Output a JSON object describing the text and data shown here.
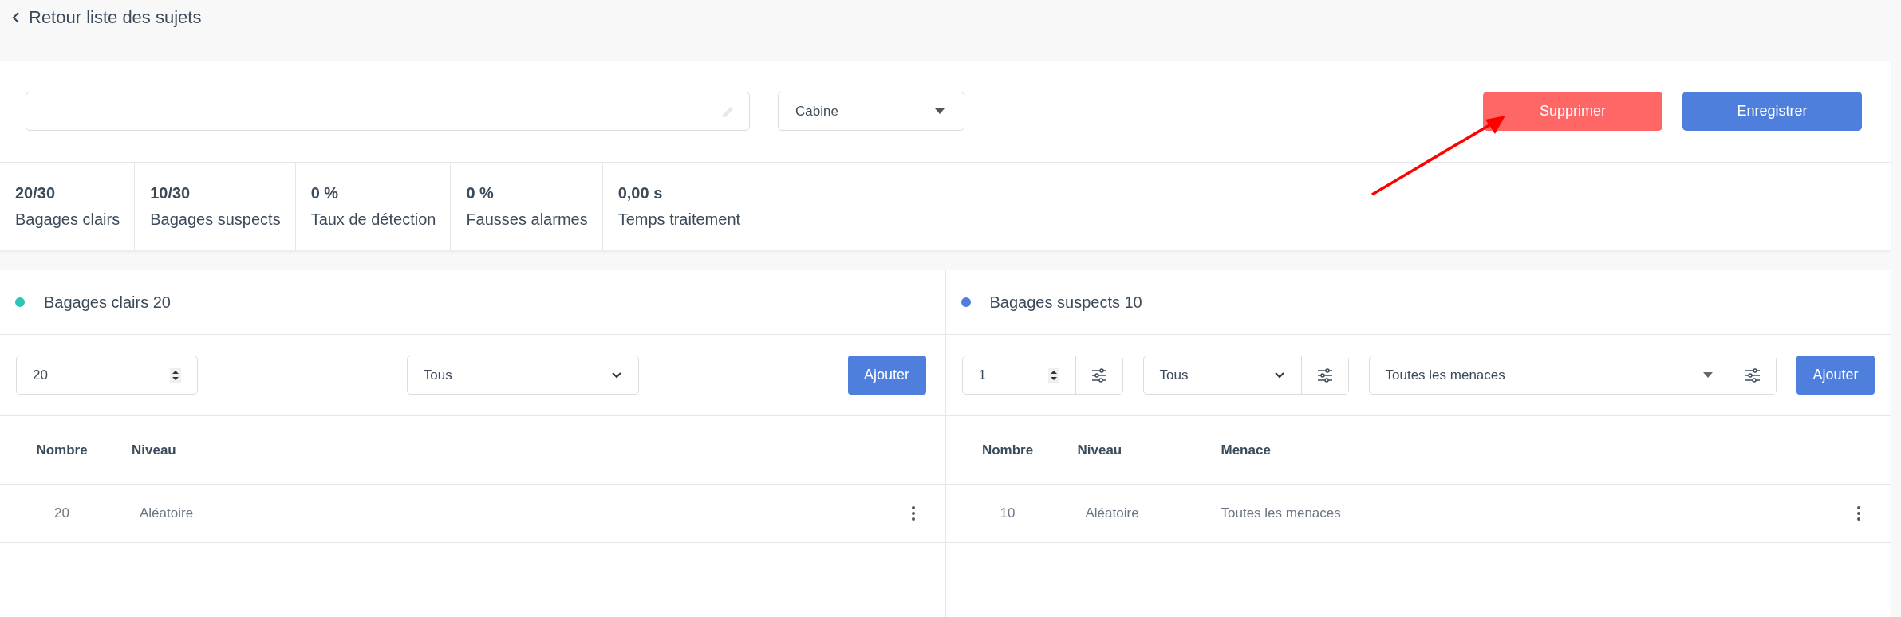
{
  "back_link": {
    "label": "Retour liste des sujets"
  },
  "form": {
    "category_select": {
      "value": "Cabine"
    },
    "buttons": [
      {
        "label": "Supprimer",
        "kind": "danger"
      },
      {
        "label": "Enregistrer",
        "kind": "primary"
      }
    ]
  },
  "stats": [
    {
      "value": "20/30",
      "label": "Bagages clairs"
    },
    {
      "value": "10/30",
      "label": "Bagages suspects"
    },
    {
      "value": "0 %",
      "label": "Taux de détection"
    },
    {
      "value": "0 %",
      "label": "Fausses alarmes"
    },
    {
      "value": "0,00 s",
      "label": "Temps traitement"
    }
  ],
  "panels": [
    {
      "title": "Bagages clairs 20",
      "color": "#2ec4b6",
      "controls": [
        {
          "kind": "number",
          "value": "20",
          "filter": false
        },
        {
          "kind": "select",
          "value": "Tous",
          "filter": false
        },
        {
          "kind": "button",
          "label": "Ajouter"
        }
      ],
      "columns": [
        "Nombre",
        "Niveau"
      ],
      "rows": [
        [
          "20",
          "Aléatoire"
        ]
      ]
    },
    {
      "title": "Bagages suspects 10",
      "color": "#4e7fdc",
      "controls": [
        {
          "kind": "number",
          "value": "1",
          "filter": true
        },
        {
          "kind": "select",
          "value": "Tous",
          "filter": true
        },
        {
          "kind": "dropdown",
          "value": "Toutes les menaces",
          "filter": true
        },
        {
          "kind": "button",
          "label": "Ajouter"
        }
      ],
      "columns": [
        "Nombre",
        "Niveau",
        "Menace"
      ],
      "rows": [
        [
          "10",
          "Aléatoire",
          "Toutes les menaces"
        ]
      ]
    }
  ]
}
